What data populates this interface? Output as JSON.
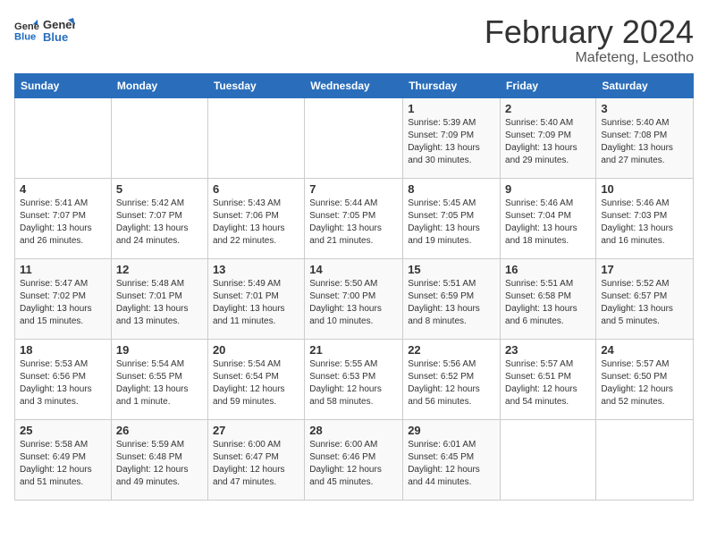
{
  "logo": {
    "line1": "General",
    "line2": "Blue"
  },
  "title": "February 2024",
  "location": "Mafeteng, Lesotho",
  "days_of_week": [
    "Sunday",
    "Monday",
    "Tuesday",
    "Wednesday",
    "Thursday",
    "Friday",
    "Saturday"
  ],
  "weeks": [
    [
      {
        "day": "",
        "detail": ""
      },
      {
        "day": "",
        "detail": ""
      },
      {
        "day": "",
        "detail": ""
      },
      {
        "day": "",
        "detail": ""
      },
      {
        "day": "1",
        "detail": "Sunrise: 5:39 AM\nSunset: 7:09 PM\nDaylight: 13 hours\nand 30 minutes."
      },
      {
        "day": "2",
        "detail": "Sunrise: 5:40 AM\nSunset: 7:09 PM\nDaylight: 13 hours\nand 29 minutes."
      },
      {
        "day": "3",
        "detail": "Sunrise: 5:40 AM\nSunset: 7:08 PM\nDaylight: 13 hours\nand 27 minutes."
      }
    ],
    [
      {
        "day": "4",
        "detail": "Sunrise: 5:41 AM\nSunset: 7:07 PM\nDaylight: 13 hours\nand 26 minutes."
      },
      {
        "day": "5",
        "detail": "Sunrise: 5:42 AM\nSunset: 7:07 PM\nDaylight: 13 hours\nand 24 minutes."
      },
      {
        "day": "6",
        "detail": "Sunrise: 5:43 AM\nSunset: 7:06 PM\nDaylight: 13 hours\nand 22 minutes."
      },
      {
        "day": "7",
        "detail": "Sunrise: 5:44 AM\nSunset: 7:05 PM\nDaylight: 13 hours\nand 21 minutes."
      },
      {
        "day": "8",
        "detail": "Sunrise: 5:45 AM\nSunset: 7:05 PM\nDaylight: 13 hours\nand 19 minutes."
      },
      {
        "day": "9",
        "detail": "Sunrise: 5:46 AM\nSunset: 7:04 PM\nDaylight: 13 hours\nand 18 minutes."
      },
      {
        "day": "10",
        "detail": "Sunrise: 5:46 AM\nSunset: 7:03 PM\nDaylight: 13 hours\nand 16 minutes."
      }
    ],
    [
      {
        "day": "11",
        "detail": "Sunrise: 5:47 AM\nSunset: 7:02 PM\nDaylight: 13 hours\nand 15 minutes."
      },
      {
        "day": "12",
        "detail": "Sunrise: 5:48 AM\nSunset: 7:01 PM\nDaylight: 13 hours\nand 13 minutes."
      },
      {
        "day": "13",
        "detail": "Sunrise: 5:49 AM\nSunset: 7:01 PM\nDaylight: 13 hours\nand 11 minutes."
      },
      {
        "day": "14",
        "detail": "Sunrise: 5:50 AM\nSunset: 7:00 PM\nDaylight: 13 hours\nand 10 minutes."
      },
      {
        "day": "15",
        "detail": "Sunrise: 5:51 AM\nSunset: 6:59 PM\nDaylight: 13 hours\nand 8 minutes."
      },
      {
        "day": "16",
        "detail": "Sunrise: 5:51 AM\nSunset: 6:58 PM\nDaylight: 13 hours\nand 6 minutes."
      },
      {
        "day": "17",
        "detail": "Sunrise: 5:52 AM\nSunset: 6:57 PM\nDaylight: 13 hours\nand 5 minutes."
      }
    ],
    [
      {
        "day": "18",
        "detail": "Sunrise: 5:53 AM\nSunset: 6:56 PM\nDaylight: 13 hours\nand 3 minutes."
      },
      {
        "day": "19",
        "detail": "Sunrise: 5:54 AM\nSunset: 6:55 PM\nDaylight: 13 hours\nand 1 minute."
      },
      {
        "day": "20",
        "detail": "Sunrise: 5:54 AM\nSunset: 6:54 PM\nDaylight: 12 hours\nand 59 minutes."
      },
      {
        "day": "21",
        "detail": "Sunrise: 5:55 AM\nSunset: 6:53 PM\nDaylight: 12 hours\nand 58 minutes."
      },
      {
        "day": "22",
        "detail": "Sunrise: 5:56 AM\nSunset: 6:52 PM\nDaylight: 12 hours\nand 56 minutes."
      },
      {
        "day": "23",
        "detail": "Sunrise: 5:57 AM\nSunset: 6:51 PM\nDaylight: 12 hours\nand 54 minutes."
      },
      {
        "day": "24",
        "detail": "Sunrise: 5:57 AM\nSunset: 6:50 PM\nDaylight: 12 hours\nand 52 minutes."
      }
    ],
    [
      {
        "day": "25",
        "detail": "Sunrise: 5:58 AM\nSunset: 6:49 PM\nDaylight: 12 hours\nand 51 minutes."
      },
      {
        "day": "26",
        "detail": "Sunrise: 5:59 AM\nSunset: 6:48 PM\nDaylight: 12 hours\nand 49 minutes."
      },
      {
        "day": "27",
        "detail": "Sunrise: 6:00 AM\nSunset: 6:47 PM\nDaylight: 12 hours\nand 47 minutes."
      },
      {
        "day": "28",
        "detail": "Sunrise: 6:00 AM\nSunset: 6:46 PM\nDaylight: 12 hours\nand 45 minutes."
      },
      {
        "day": "29",
        "detail": "Sunrise: 6:01 AM\nSunset: 6:45 PM\nDaylight: 12 hours\nand 44 minutes."
      },
      {
        "day": "",
        "detail": ""
      },
      {
        "day": "",
        "detail": ""
      }
    ]
  ]
}
